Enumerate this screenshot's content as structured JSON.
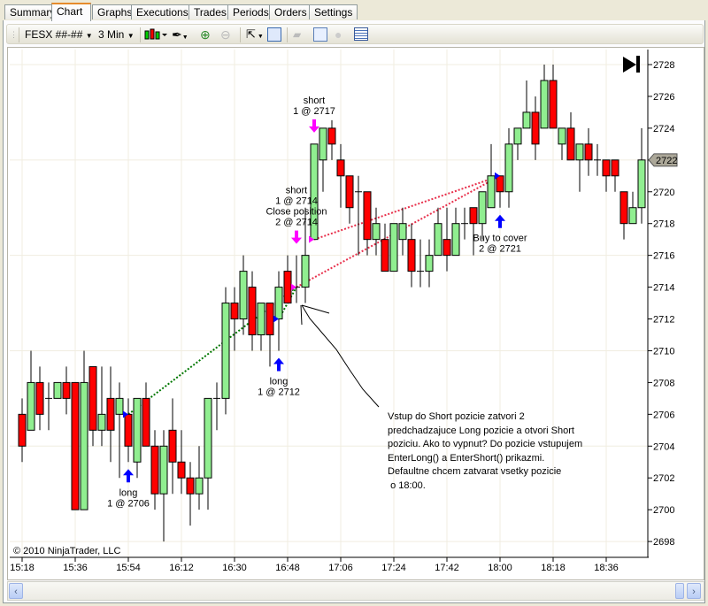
{
  "tabs": [
    "Summary",
    "Chart",
    "Graphs",
    "Executions",
    "Trades",
    "Periods",
    "Orders",
    "Settings"
  ],
  "active_tab": "Chart",
  "toolbar": {
    "instrument": "FESX ##-##",
    "interval": "3 Min"
  },
  "colors": {
    "up": "#90ee90",
    "down": "#ff0000",
    "long_arrow": "#0000ff",
    "short_arrow": "#ff00ff",
    "long_trade_line": "#007700",
    "short_trade_line": "#e8304c",
    "grid": "#f0ede0"
  },
  "copyright": "© 2010 NinjaTrader, LLC",
  "last_price": "2722",
  "note": "Vstup do Short pozicie zatvori 2\npredchadzajuce Long pozicie a otvori Short\npoziciu. Ako to vypnut? Do pozicie vstupujem\nEnterLong() a EnterShort() prikazmi.\nDefaultne chcem zatvarat vsetky pozicie\n o 18:00.",
  "chart_data": {
    "type": "candlestick",
    "x_tick_labels": [
      "15:18",
      "15:36",
      "15:54",
      "16:12",
      "16:30",
      "16:48",
      "17:06",
      "17:24",
      "17:42",
      "18:00",
      "18:18",
      "18:36"
    ],
    "first_bar": "15:18",
    "bar_interval_min": 3,
    "y_tick_labels": [
      "2728",
      "2726",
      "2724",
      "2722",
      "2720",
      "2718",
      "2716",
      "2714",
      "2712",
      "2710",
      "2708",
      "2706",
      "2704",
      "2702",
      "2700",
      "2698"
    ],
    "ylim": [
      2697,
      2731
    ],
    "ohlc": [
      [
        2706,
        2707,
        2703,
        2704
      ],
      [
        2705,
        2710,
        2705,
        2708
      ],
      [
        2708,
        2709,
        2705,
        2706
      ],
      [
        2707,
        2708,
        2705,
        2707
      ],
      [
        2707,
        2708,
        2707,
        2708
      ],
      [
        2708,
        2709,
        2706,
        2707
      ],
      [
        2708,
        2708,
        2700,
        2700
      ],
      [
        2700,
        2710,
        2700,
        2708
      ],
      [
        2709,
        2709,
        2704,
        2705
      ],
      [
        2705,
        2709,
        2704,
        2706
      ],
      [
        2707,
        2709,
        2703,
        2705
      ],
      [
        2706,
        2708,
        2702,
        2707
      ],
      [
        2706,
        2707,
        2703,
        2704
      ],
      [
        2703,
        2707,
        2702,
        2707
      ],
      [
        2707,
        2708,
        2704,
        2704
      ],
      [
        2704,
        2705,
        2700,
        2701
      ],
      [
        2701,
        2705,
        2698,
        2704
      ],
      [
        2705,
        2707,
        2701,
        2703
      ],
      [
        2703,
        2705,
        2701,
        2702
      ],
      [
        2702,
        2703,
        2699,
        2701
      ],
      [
        2701,
        2704,
        2700,
        2702
      ],
      [
        2702,
        2707,
        2700,
        2707
      ],
      [
        2707,
        2708,
        2705,
        2707
      ],
      [
        2707,
        2714,
        2706,
        2713
      ],
      [
        2713,
        2714,
        2710,
        2712
      ],
      [
        2712,
        2716,
        2711,
        2715
      ],
      [
        2714,
        2715,
        2710,
        2711
      ],
      [
        2711,
        2713,
        2710,
        2713
      ],
      [
        2713,
        2713,
        2709,
        2711
      ],
      [
        2712,
        2715,
        2710,
        2714
      ],
      [
        2715,
        2716,
        2713,
        2713
      ],
      [
        2714,
        2716,
        2713,
        2714
      ],
      [
        2714,
        2719,
        2713,
        2716
      ],
      [
        2717,
        2723,
        2717,
        2723
      ],
      [
        2722,
        2724,
        2720,
        2724
      ],
      [
        2724,
        2724.5,
        2722,
        2723
      ],
      [
        2722,
        2723,
        2719,
        2721
      ],
      [
        2721,
        2721,
        2718,
        2719
      ],
      [
        2720,
        2721,
        2716,
        2720
      ],
      [
        2720,
        2720,
        2716,
        2717
      ],
      [
        2717,
        2719,
        2716,
        2718
      ],
      [
        2717,
        2718,
        2715,
        2715
      ],
      [
        2715,
        2718,
        2715,
        2718
      ],
      [
        2717,
        2719,
        2716,
        2718
      ],
      [
        2717,
        2718,
        2714,
        2715
      ],
      [
        2715,
        2717,
        2714,
        2715
      ],
      [
        2715,
        2717,
        2714,
        2716
      ],
      [
        2716,
        2719,
        2716,
        2718
      ],
      [
        2717,
        2719,
        2715,
        2716
      ],
      [
        2716,
        2719,
        2716,
        2718
      ],
      [
        2718,
        2719,
        2717,
        2718
      ],
      [
        2719,
        2719,
        2716,
        2718
      ],
      [
        2718,
        2720,
        2717,
        2720
      ],
      [
        2719,
        2723,
        2719,
        2721
      ],
      [
        2721,
        2721,
        2719,
        2720
      ],
      [
        2720,
        2724,
        2719,
        2723
      ],
      [
        2723,
        2724,
        2722,
        2724
      ],
      [
        2724,
        2727,
        2724,
        2725
      ],
      [
        2725,
        2726,
        2722,
        2723
      ],
      [
        2724,
        2728,
        2724,
        2727
      ],
      [
        2727,
        2728,
        2724,
        2724
      ],
      [
        2723,
        2724,
        2722,
        2724
      ],
      [
        2724,
        2725,
        2722,
        2722
      ],
      [
        2722,
        2723,
        2720,
        2723
      ],
      [
        2723,
        2724,
        2721,
        2722
      ],
      [
        2722,
        2723,
        2721,
        2722
      ],
      [
        2722,
        2722,
        2720,
        2721
      ],
      [
        2722,
        2722,
        2720,
        2721
      ],
      [
        2720,
        2720,
        2717,
        2718
      ],
      [
        2718,
        2720,
        2718,
        2719
      ],
      [
        2719,
        2724,
        2718,
        2722
      ]
    ],
    "executions": [
      {
        "bar": 12,
        "side": "long",
        "price": 2706,
        "lines": [
          "long",
          "1 @ 2706"
        ]
      },
      {
        "bar": 29,
        "side": "long",
        "price": 2712,
        "lines": [
          "long",
          "1 @ 2712"
        ]
      },
      {
        "bar": 31,
        "side": "short",
        "price": 2714,
        "lines": [
          "short",
          "1 @ 2714",
          "Close position",
          "2 @ 2714"
        ]
      },
      {
        "bar": 33,
        "side": "short",
        "price": 2717,
        "lines": [
          "short",
          "1 @ 2717"
        ]
      },
      {
        "bar": 54,
        "side": "cover",
        "price": 2721,
        "lines": [
          "Buy to cover",
          "2 @ 2721"
        ]
      }
    ],
    "trades": [
      {
        "from_bar": 12,
        "from_price": 2706,
        "to_bar": 31,
        "to_price": 2714,
        "kind": "long"
      },
      {
        "from_bar": 29,
        "from_price": 2712,
        "to_bar": 31,
        "to_price": 2714,
        "kind": "long"
      },
      {
        "from_bar": 31,
        "from_price": 2714,
        "to_bar": 54,
        "to_price": 2721,
        "kind": "short"
      },
      {
        "from_bar": 33,
        "from_price": 2717,
        "to_bar": 54,
        "to_price": 2721,
        "kind": "short"
      }
    ]
  }
}
